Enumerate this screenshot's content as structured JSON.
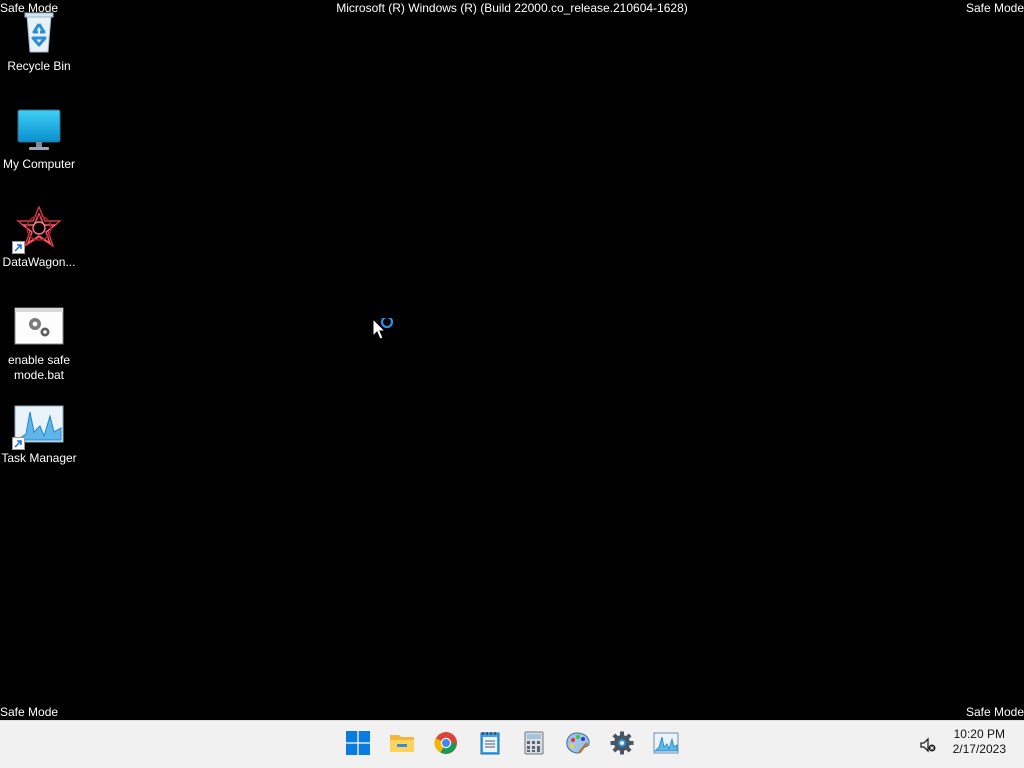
{
  "overlay": {
    "safe_mode_tl": "Safe Mode",
    "safe_mode_tr": "Safe Mode",
    "safe_mode_bl": "Safe Mode",
    "safe_mode_br": "Safe Mode",
    "build_string": "Microsoft (R) Windows (R) (Build 22000.co_release.210604-1628)"
  },
  "desktop": {
    "icons": [
      {
        "label": "Recycle Bin",
        "icon": "recycle-bin-icon"
      },
      {
        "label": "My Computer",
        "icon": "monitor-icon"
      },
      {
        "label": "DataWagon...",
        "icon": "datawagon-icon"
      },
      {
        "label": "enable safe mode.bat",
        "icon": "batch-file-icon"
      },
      {
        "label": "Task Manager",
        "icon": "task-manager-icon"
      }
    ]
  },
  "taskbar": {
    "apps": [
      "start-icon",
      "file-explorer-icon",
      "chrome-icon",
      "notepad-icon",
      "calculator-icon",
      "paint-icon",
      "settings-icon",
      "task-manager-icon"
    ],
    "clock": {
      "time": "10:20 PM",
      "date": "2/17/2023"
    }
  },
  "colors": {
    "desktop_bg": "#000000",
    "taskbar_bg": "#f1f1f1",
    "accent": "#0078d4"
  }
}
